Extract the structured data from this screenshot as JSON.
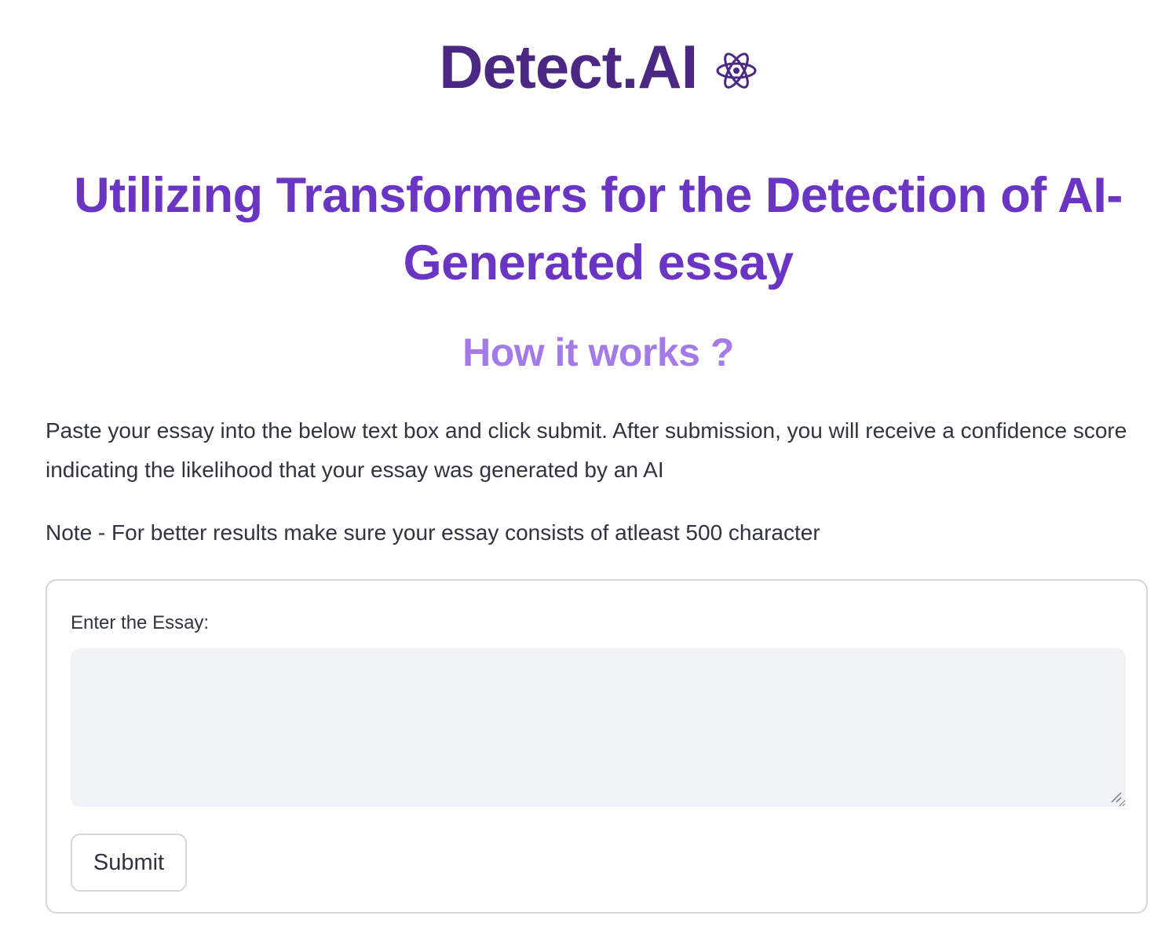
{
  "brand": {
    "title": "Detect.AI",
    "icon": "atom-icon"
  },
  "headline": "Utilizing Transformers for the Detection of AI-Generated essay",
  "subhead": "How it works ?",
  "description": "Paste your essay into the below text box and click submit. After submission, you will receive a confidence score indicating the likelihood that your essay was generated by an AI",
  "note": "Note - For better results make sure your essay consists of atleast 500 character",
  "form": {
    "label": "Enter the Essay:",
    "essay_value": "",
    "essay_placeholder": "",
    "submit_label": "Submit"
  },
  "colors": {
    "brand": "#4a2883",
    "headline": "#6a35c2",
    "subhead": "#a37ae8",
    "input_bg": "#f0f2f6",
    "border": "#d6d6d9",
    "text": "#31333f"
  }
}
